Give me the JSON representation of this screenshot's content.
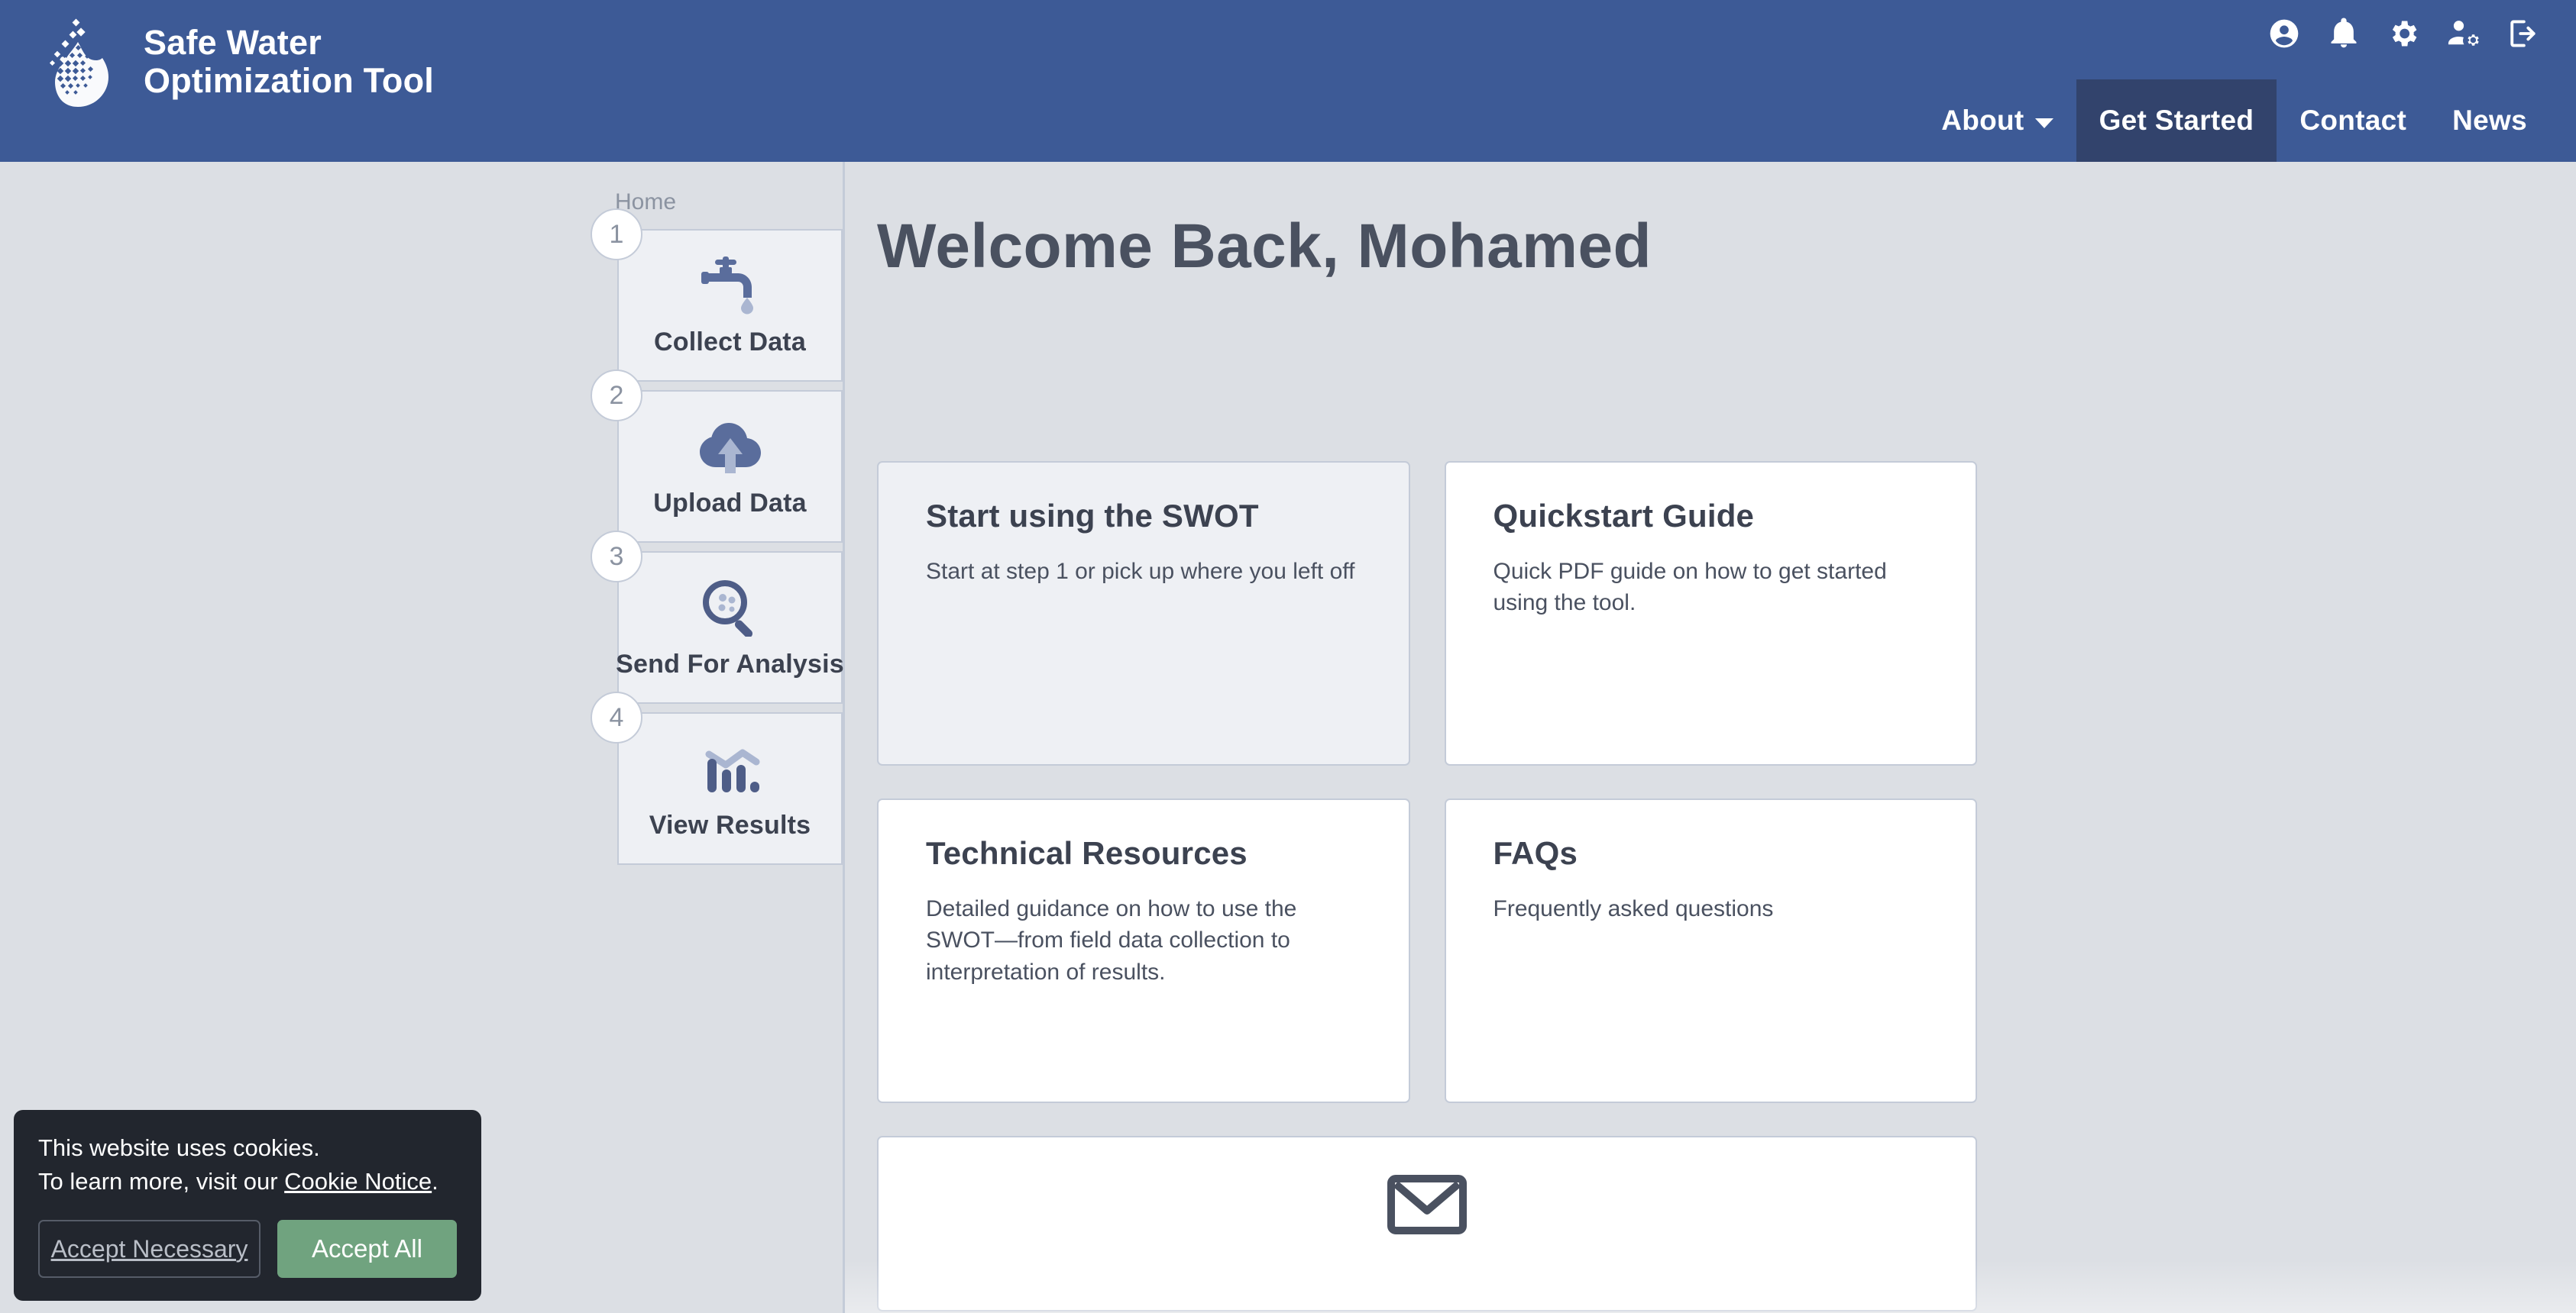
{
  "brand": {
    "line1": "Safe Water",
    "line2": "Optimization Tool",
    "logo_icon": "water-droplet-dots-logo"
  },
  "header": {
    "background": "#3d5a96",
    "active_background": "#32436c",
    "accent": "#edc351",
    "icons": [
      {
        "name": "account-circle-icon",
        "label": "Account"
      },
      {
        "name": "bell-icon",
        "label": "Notifications"
      },
      {
        "name": "gear-icon",
        "label": "Settings"
      },
      {
        "name": "user-cog-icon",
        "label": "Manage Users"
      },
      {
        "name": "logout-icon",
        "label": "Log Out"
      }
    ],
    "nav": [
      {
        "label": "About",
        "has_caret": true,
        "active": false
      },
      {
        "label": "Get Started",
        "has_caret": false,
        "active": true
      },
      {
        "label": "Contact",
        "has_caret": false,
        "active": false
      },
      {
        "label": "News",
        "has_caret": false,
        "active": false
      }
    ]
  },
  "breadcrumb": {
    "label": "Home"
  },
  "steps": [
    {
      "number": "1",
      "label": "Collect Data",
      "icon": "faucet-drop-icon"
    },
    {
      "number": "2",
      "label": "Upload Data",
      "icon": "cloud-upload-icon"
    },
    {
      "number": "3",
      "label": "Send For Analysis",
      "icon": "magnifier-dots-icon"
    },
    {
      "number": "4",
      "label": "View Results",
      "icon": "bar-chart-trend-icon"
    }
  ],
  "main": {
    "welcome_title": "Welcome Back, Mohamed",
    "cards": [
      {
        "title": "Start using the SWOT",
        "desc": "Start at step 1 or pick up where you left off",
        "highlight": true
      },
      {
        "title": "Quickstart Guide",
        "desc": "Quick PDF guide on how to get started using the tool.",
        "highlight": false
      },
      {
        "title": "Technical Resources",
        "desc": "Detailed guidance on how to use the SWOT—from field data collection to interpretation of results.",
        "highlight": false
      },
      {
        "title": "FAQs",
        "desc": "Frequently asked questions",
        "highlight": false
      }
    ],
    "mail_card": {
      "icon": "envelope-icon"
    }
  },
  "cookie_banner": {
    "line1": "This website uses cookies.",
    "line2_prefix": "To learn more, visit our ",
    "link_label": "Cookie Notice",
    "line2_suffix": ".",
    "accept_necessary_label": "Accept Necessary",
    "accept_all_label": "Accept All",
    "accept_all_color": "#70a37f"
  }
}
